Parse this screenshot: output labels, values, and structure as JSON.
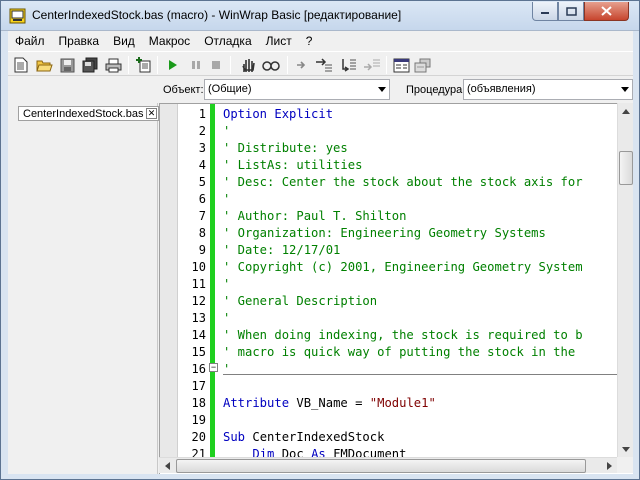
{
  "window": {
    "title": "CenterIndexedStock.bas (macro) - WinWrap Basic [редактирование]"
  },
  "menu": {
    "items": [
      {
        "label": "Файл"
      },
      {
        "label": "Правка"
      },
      {
        "label": "Вид"
      },
      {
        "label": "Макрос"
      },
      {
        "label": "Отладка"
      },
      {
        "label": "Лист"
      },
      {
        "label": "?"
      }
    ]
  },
  "toolbar": {
    "buttons": [
      "new-icon",
      "open-icon",
      "save-icon",
      "save-all-icon",
      "print-icon",
      "add-module-icon",
      "run-icon",
      "pause-icon",
      "stop-icon",
      "toggle-breakpoint-icon",
      "quick-watch-icon",
      "step-into-icon",
      "step-over-icon",
      "step-out-icon",
      "step-to-cursor-icon",
      "object-browser-icon",
      "references-icon"
    ]
  },
  "selectors": {
    "object_label": "Объект:",
    "object_value": "(Общие)",
    "procedure_label": "Процедура:",
    "procedure_value": "(объявления)"
  },
  "tabs": [
    {
      "label": "CenterIndexedStock.bas"
    }
  ],
  "editor": {
    "line_numbers": [
      "1",
      "2",
      "3",
      "4",
      "5",
      "6",
      "7",
      "8",
      "9",
      "10",
      "11",
      "12",
      "13",
      "14",
      "15",
      "16",
      "17",
      "18",
      "19",
      "20",
      "21"
    ],
    "lines": [
      [
        {
          "t": "kw",
          "v": "Option Explicit"
        }
      ],
      [
        {
          "t": "cm",
          "v": "'"
        }
      ],
      [
        {
          "t": "cm",
          "v": "' Distribute: yes"
        }
      ],
      [
        {
          "t": "cm",
          "v": "' ListAs: utilities"
        }
      ],
      [
        {
          "t": "cm",
          "v": "' Desc: Center the stock about the stock axis for"
        }
      ],
      [
        {
          "t": "cm",
          "v": "'"
        }
      ],
      [
        {
          "t": "cm",
          "v": "' Author: Paul T. Shilton"
        }
      ],
      [
        {
          "t": "cm",
          "v": "' Organization: Engineering Geometry Systems"
        }
      ],
      [
        {
          "t": "cm",
          "v": "' Date: 12/17/01"
        }
      ],
      [
        {
          "t": "cm",
          "v": "' Copyright (c) 2001, Engineering Geometry System"
        }
      ],
      [
        {
          "t": "cm",
          "v": "'"
        }
      ],
      [
        {
          "t": "cm",
          "v": "' General Description"
        }
      ],
      [
        {
          "t": "cm",
          "v": "'"
        }
      ],
      [
        {
          "t": "cm",
          "v": "' When doing indexing, the stock is required to b"
        }
      ],
      [
        {
          "t": "cm",
          "v": "' macro is quick way of putting the stock in the"
        }
      ],
      [
        {
          "t": "cm",
          "v": "'"
        }
      ],
      [
        {
          "t": "pl",
          "v": ""
        }
      ],
      [
        {
          "t": "kw",
          "v": "Attribute"
        },
        {
          "t": "pl",
          "v": " VB_Name = "
        },
        {
          "t": "str",
          "v": "\"Module1\""
        }
      ],
      [
        {
          "t": "pl",
          "v": ""
        }
      ],
      [
        {
          "t": "kw",
          "v": "Sub"
        },
        {
          "t": "pl",
          "v": " CenterIndexedStock"
        }
      ],
      [
        {
          "t": "pl",
          "v": "    "
        },
        {
          "t": "kw",
          "v": "Dim"
        },
        {
          "t": "pl",
          "v": " Doc "
        },
        {
          "t": "kw",
          "v": "As"
        },
        {
          "t": "pl",
          "v": " FMDocument"
        }
      ]
    ]
  }
}
